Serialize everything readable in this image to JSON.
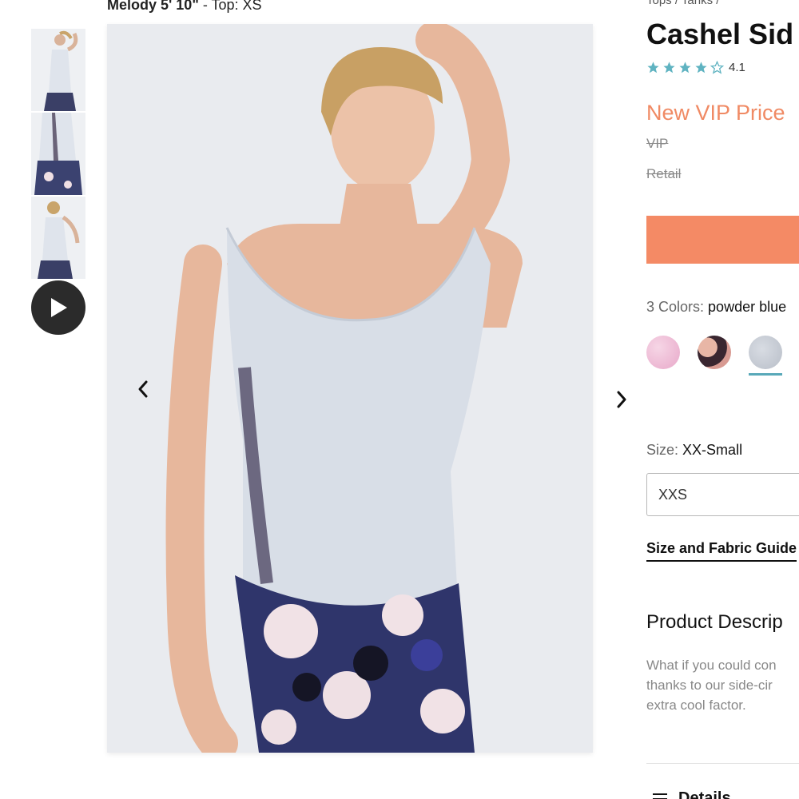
{
  "model_info": {
    "name": "Melody 5' 10\"",
    "separator": " - ",
    "size": "Top: XS"
  },
  "breadcrumb": "Tops / Tanks /",
  "product": {
    "title": "Cashel Sid",
    "rating": {
      "value": "4.1",
      "stars": 4,
      "max": 5
    },
    "price_label": "New VIP Price",
    "vip_label": "VIP",
    "retail_label": "Retail",
    "cta_color": "#f48a65"
  },
  "colors": {
    "label": "3 Colors:",
    "selected": "powder blue",
    "options": [
      "pink",
      "rose",
      "powder blue"
    ]
  },
  "size": {
    "label": "Size:",
    "selected": "XX-Small",
    "select_value": "XXS",
    "guide_link": "Size and Fabric Guide"
  },
  "description": {
    "heading": "Product Descrip",
    "lines": [
      "What if you could con",
      "thanks to our side-cir",
      "extra cool factor."
    ]
  },
  "details_label": "Details",
  "icons": [
    "play-icon",
    "chevron-left-icon",
    "chevron-right-icon",
    "star-icon",
    "list-icon"
  ],
  "theme": {
    "accent": "#f48a65",
    "star": "#5fb3c1",
    "selected_swatch_underline": "#59a9b9"
  }
}
